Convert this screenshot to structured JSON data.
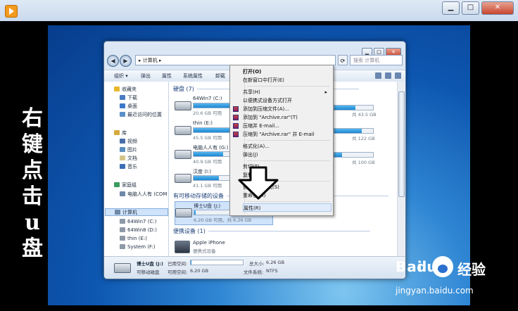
{
  "player": {
    "controls": [
      "▁",
      "□",
      "✕"
    ]
  },
  "left_text": [
    "右",
    "键",
    "点",
    "击",
    "u",
    "盘"
  ],
  "explorer": {
    "address": "▸ 计算机 ▸",
    "search_placeholder": "搜索 计算机",
    "toolbar": [
      "组织 ▾",
      "弹出",
      "属性",
      "系统属性",
      "卸载"
    ],
    "nav": [
      {
        "label": "收藏夹",
        "icon": "star-icon",
        "color": "#e8b92c"
      },
      {
        "label": "下载",
        "icon": "download-folder-icon",
        "color": "#4a7bc4"
      },
      {
        "label": "桌面",
        "icon": "desktop-icon",
        "color": "#3b78c9"
      },
      {
        "label": "最近访问的位置",
        "icon": "recent-places-icon",
        "color": "#5c8fc9"
      },
      {
        "label": "库",
        "icon": "library-icon",
        "color": "#d6a93c"
      },
      {
        "label": "视频",
        "icon": "video-icon",
        "color": "#4a6ea8"
      },
      {
        "label": "图片",
        "icon": "pictures-icon",
        "color": "#5a8fc0"
      },
      {
        "label": "文档",
        "icon": "documents-icon",
        "color": "#d7c38a"
      },
      {
        "label": "音乐",
        "icon": "music-icon",
        "color": "#3d6fb8"
      },
      {
        "label": "家庭组",
        "icon": "homegroup-icon",
        "color": "#3c9b5e"
      },
      {
        "label": "电脑人人有 (COM",
        "icon": "computer-icon",
        "color": "#6e88a8"
      },
      {
        "label": "计算机",
        "icon": "computer-icon",
        "color": "#6e88a8"
      },
      {
        "label": "64Win7 (C:)",
        "icon": "drive-icon",
        "color": "#8d99a8"
      },
      {
        "label": "64Win8 (D:)",
        "icon": "drive-icon",
        "color": "#8d99a8"
      },
      {
        "label": "thin (E:)",
        "icon": "drive-icon",
        "color": "#8d99a8"
      },
      {
        "label": "System (F:)",
        "icon": "drive-icon",
        "color": "#8d99a8"
      }
    ],
    "sections": {
      "hdd": "硬盘 (7)",
      "removable": "有可移动存储的设备",
      "portable": "便携设备 (1)"
    },
    "drives": [
      {
        "name": "64Win7 (C:)",
        "free": "20.6 GB 可用",
        "fill": 0.55
      },
      {
        "name": "thin (E:)",
        "free": "45.5 GB 可用",
        "fill": 0.45
      },
      {
        "name": "电脑人人有 (G:)",
        "free": "40.9 GB 可用",
        "fill": 0.35
      },
      {
        "name": "汉度 (I:)",
        "free": "41.1 GB 可用",
        "fill": 0.3
      }
    ],
    "right_drives": [
      {
        "free": "共 43.5 GB",
        "fill": 0.55
      },
      {
        "free": "共 122 GB",
        "fill": 0.7
      },
      {
        "free": "共 100 GB",
        "fill": 0.2
      }
    ],
    "usb": {
      "name": "博士U盘 (J:)",
      "free": "6.20 GB 可用，共 6.26 GB",
      "fill": 0.02
    },
    "phone": {
      "name": "Apple iPhone",
      "type": "便携式设备"
    },
    "details": {
      "name": "博士U盘 (J:)",
      "type": "可移动磁盘",
      "used_label": "已用空间:",
      "free_label": "可用空间:",
      "free_value": "6.20 GB",
      "total_label": "总大小:",
      "total_value": "6.26 GB",
      "fs_label": "文件系统:",
      "fs_value": "NTFS"
    }
  },
  "context_menu": [
    {
      "label": "打开(O)",
      "bold": true
    },
    {
      "label": "在新窗口中打开(E)"
    },
    {
      "sep": true
    },
    {
      "label": "共享(H)",
      "arrow": "▸"
    },
    {
      "label": "以便携式设备方式打开"
    },
    {
      "label": "添加到压缩文件(A)...",
      "rar": true
    },
    {
      "label": "添加到 \"Archive.rar\"(T)",
      "rar": true
    },
    {
      "label": "压缩并 E-mail...",
      "rar": true
    },
    {
      "label": "压缩到 \"Archive.rar\" 并 E-mail",
      "rar": true
    },
    {
      "sep": true
    },
    {
      "label": "格式化(A)..."
    },
    {
      "label": "弹出(J)"
    },
    {
      "sep": true
    },
    {
      "label": "剪切(T)"
    },
    {
      "label": "复制(C)"
    },
    {
      "sep": true
    },
    {
      "label": "创建快捷方式(S)"
    },
    {
      "label": "重命名(M)"
    },
    {
      "sep": true
    },
    {
      "label": "属性(R)",
      "selected": true
    }
  ],
  "watermark": {
    "logo": "Bai",
    "logo2": "du",
    "jingyan": "经验",
    "url": "jingyan.baidu.com"
  }
}
